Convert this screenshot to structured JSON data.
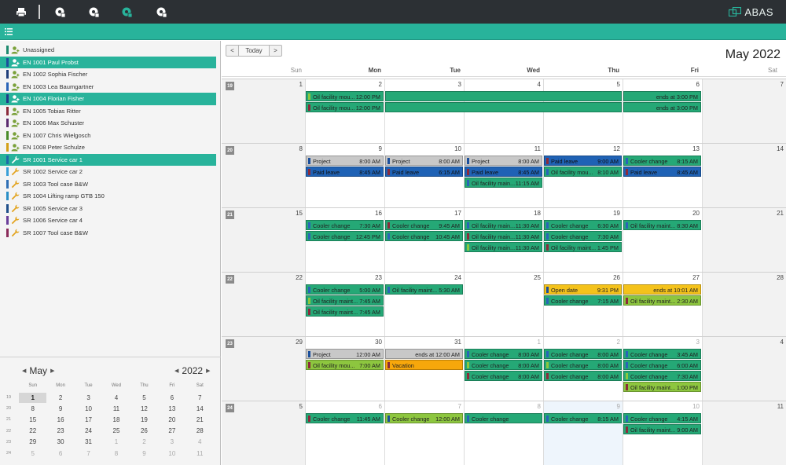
{
  "toolbar": {
    "icons": [
      "printer-icon",
      "gear-view-icon",
      "gear-view-icon",
      "gear-view-active-icon",
      "gear-view-icon"
    ],
    "logo_text": "ABAS"
  },
  "colors": {
    "toolbar_bg": "#2c3034",
    "accent": "#28b39b",
    "event_green": "#25a876",
    "event_gray": "#c8c8c8",
    "event_blue": "#1f62b5",
    "event_lime": "#8dc63f",
    "event_yellow": "#f4c21b",
    "event_orange": "#f7a70b"
  },
  "resources": [
    {
      "label": "Unassigned",
      "bar": "#1e8a6e",
      "icon": "person-icon",
      "selected": false
    },
    {
      "label": "EN 1001 Paul Probst",
      "bar": "#1b4f9c",
      "icon": "person-icon",
      "selected": true
    },
    {
      "label": "EN 1002 Sophia Fischer",
      "bar": "#1f3e7a",
      "icon": "person-icon",
      "selected": false
    },
    {
      "label": "EN 1003 Lea Baumgartner",
      "bar": "#2a64b7",
      "icon": "person-icon",
      "selected": false
    },
    {
      "label": "EN 1004 Florian Fisher",
      "bar": "#1e3a8a",
      "icon": "person-icon",
      "selected": true
    },
    {
      "label": "EN 1005 Tobias Ritter",
      "bar": "#8b2b3b",
      "icon": "person-icon",
      "selected": false
    },
    {
      "label": "EN 1006 Max Schuster",
      "bar": "#5b2a6e",
      "icon": "person-icon",
      "selected": false
    },
    {
      "label": "EN 1007 Chris Wielgosch",
      "bar": "#4a8c2a",
      "icon": "person-icon",
      "selected": false
    },
    {
      "label": "EN 1008 Peter Schulze",
      "bar": "#d4a017",
      "icon": "person-icon",
      "selected": false
    },
    {
      "label": "SR 1001 Service car 1",
      "bar": "#1e6aa8",
      "icon": "wrench-icon",
      "selected": true
    },
    {
      "label": "SR 1002 Service car 2",
      "bar": "#3aa0d8",
      "icon": "wrench-icon",
      "selected": false
    },
    {
      "label": "SR 1003 Tool case B&W",
      "bar": "#2f6fb5",
      "icon": "wrench-icon",
      "selected": false
    },
    {
      "label": "SR 1004 Lifting ramp GTB 150",
      "bar": "#2a8fc6",
      "icon": "wrench-icon",
      "selected": false
    },
    {
      "label": "SR 1005 Service car 3",
      "bar": "#1f4f8a",
      "icon": "wrench-icon",
      "selected": false
    },
    {
      "label": "SR 1006 Service car 4",
      "bar": "#6a3d9a",
      "icon": "wrench-icon",
      "selected": false
    },
    {
      "label": "SR 1007 Tool case B&W",
      "bar": "#8a2a5a",
      "icon": "wrench-icon",
      "selected": false
    }
  ],
  "minical": {
    "month": "May",
    "year": "2022",
    "dow": [
      "Sun",
      "Mon",
      "Tue",
      "Wed",
      "Thu",
      "Fri",
      "Sat"
    ],
    "weeks": [
      {
        "wk": "19",
        "days": [
          {
            "d": "1",
            "c": "today"
          },
          {
            "d": "2"
          },
          {
            "d": "3"
          },
          {
            "d": "4"
          },
          {
            "d": "5"
          },
          {
            "d": "6"
          },
          {
            "d": "7"
          }
        ]
      },
      {
        "wk": "20",
        "days": [
          {
            "d": "8"
          },
          {
            "d": "9"
          },
          {
            "d": "10"
          },
          {
            "d": "11"
          },
          {
            "d": "12"
          },
          {
            "d": "13"
          },
          {
            "d": "14"
          }
        ]
      },
      {
        "wk": "21",
        "days": [
          {
            "d": "15"
          },
          {
            "d": "16"
          },
          {
            "d": "17"
          },
          {
            "d": "18"
          },
          {
            "d": "19"
          },
          {
            "d": "20"
          },
          {
            "d": "21"
          }
        ]
      },
      {
        "wk": "22",
        "days": [
          {
            "d": "22"
          },
          {
            "d": "23"
          },
          {
            "d": "24"
          },
          {
            "d": "25"
          },
          {
            "d": "26"
          },
          {
            "d": "27"
          },
          {
            "d": "28"
          }
        ]
      },
      {
        "wk": "23",
        "days": [
          {
            "d": "29"
          },
          {
            "d": "30"
          },
          {
            "d": "31"
          },
          {
            "d": "1",
            "c": "other"
          },
          {
            "d": "2",
            "c": "other"
          },
          {
            "d": "3",
            "c": "other"
          },
          {
            "d": "4",
            "c": "other"
          }
        ]
      },
      {
        "wk": "24",
        "days": [
          {
            "d": "5",
            "c": "other"
          },
          {
            "d": "6",
            "c": "other"
          },
          {
            "d": "7",
            "c": "other"
          },
          {
            "d": "8",
            "c": "other"
          },
          {
            "d": "9",
            "c": "other"
          },
          {
            "d": "10",
            "c": "other"
          },
          {
            "d": "11",
            "c": "other"
          }
        ]
      }
    ]
  },
  "calendar": {
    "today_label": "Today",
    "prev_label": "<",
    "next_label": ">",
    "title": "May 2022",
    "dow": [
      "Sun",
      "Mon",
      "Tue",
      "Wed",
      "Thu",
      "Fri",
      "Sat"
    ],
    "weeks": [
      {
        "wk": "19",
        "days": [
          {
            "d": "1"
          },
          {
            "d": "2"
          },
          {
            "d": "3"
          },
          {
            "d": "4"
          },
          {
            "d": "5"
          },
          {
            "d": "6"
          },
          {
            "d": "7"
          }
        ],
        "events": [
          {
            "col": 1,
            "span": 1,
            "row": 0,
            "text": "Oil facility mou...",
            "time": "12:00 PM",
            "color": "event_green",
            "bar": "#8dc63f"
          },
          {
            "col": 2,
            "span": 3,
            "row": 0,
            "text": "",
            "time": "",
            "color": "event_green",
            "bar": ""
          },
          {
            "col": 5,
            "span": 1,
            "row": 0,
            "text": "",
            "time": "ends at 3:00 PM",
            "color": "event_green",
            "bar": ""
          },
          {
            "col": 1,
            "span": 1,
            "row": 1,
            "text": "Oil facility mou...",
            "time": "12:00 PM",
            "color": "event_green",
            "bar": "#8b2b3b"
          },
          {
            "col": 2,
            "span": 3,
            "row": 1,
            "text": "",
            "time": "",
            "color": "event_green",
            "bar": ""
          },
          {
            "col": 5,
            "span": 1,
            "row": 1,
            "text": "",
            "time": "ends at 3:00 PM",
            "color": "event_green",
            "bar": ""
          }
        ]
      },
      {
        "wk": "20",
        "days": [
          {
            "d": "8"
          },
          {
            "d": "9"
          },
          {
            "d": "10"
          },
          {
            "d": "11"
          },
          {
            "d": "12"
          },
          {
            "d": "13"
          },
          {
            "d": "14"
          }
        ],
        "events": [
          {
            "col": 1,
            "row": 0,
            "text": "Project",
            "time": "8:00 AM",
            "color": "event_gray",
            "bar": "#1b4f9c"
          },
          {
            "col": 2,
            "row": 0,
            "text": "Project",
            "time": "8:00 AM",
            "color": "event_gray",
            "bar": "#1b4f9c"
          },
          {
            "col": 3,
            "row": 0,
            "text": "Project",
            "time": "8:00 AM",
            "color": "event_gray",
            "bar": "#1b4f9c"
          },
          {
            "col": 4,
            "row": 0,
            "text": "Paid leave",
            "time": "9:00 AM",
            "color": "event_blue",
            "bar": "#8b2b3b"
          },
          {
            "col": 5,
            "row": 0,
            "text": "Cooler change",
            "time": "8:15 AM",
            "color": "event_green",
            "bar": "#2a64b7"
          },
          {
            "col": 1,
            "row": 1,
            "text": "Paid leave",
            "time": "8:45 AM",
            "color": "event_blue",
            "bar": "#8b2b3b"
          },
          {
            "col": 2,
            "row": 1,
            "text": "Paid leave",
            "time": "6:15 AM",
            "color": "event_blue",
            "bar": "#8b2b3b"
          },
          {
            "col": 3,
            "row": 1,
            "text": "Paid leave",
            "time": "8:45 AM",
            "color": "event_blue",
            "bar": "#8b2b3b"
          },
          {
            "col": 4,
            "row": 1,
            "text": "Oil facility mou...",
            "time": "8:10 AM",
            "color": "event_green",
            "bar": "#2a64b7"
          },
          {
            "col": 5,
            "row": 1,
            "text": "Paid leave",
            "time": "8:45 AM",
            "color": "event_blue",
            "bar": "#8b2b3b"
          },
          {
            "col": 3,
            "row": 2,
            "text": "Oil facility main...",
            "time": "11:15 AM",
            "color": "event_green",
            "bar": "#2a64b7"
          }
        ]
      },
      {
        "wk": "21",
        "days": [
          {
            "d": "15"
          },
          {
            "d": "16"
          },
          {
            "d": "17"
          },
          {
            "d": "18"
          },
          {
            "d": "19"
          },
          {
            "d": "20"
          },
          {
            "d": "21"
          }
        ],
        "events": [
          {
            "col": 1,
            "row": 0,
            "text": "Cooler change",
            "time": "7:30 AM",
            "color": "event_green",
            "bar": "#2a64b7"
          },
          {
            "col": 2,
            "row": 0,
            "text": "Cooler change",
            "time": "9:45 AM",
            "color": "event_green",
            "bar": "#8b2b3b"
          },
          {
            "col": 3,
            "row": 0,
            "text": "Oil facility main...",
            "time": "11:30 AM",
            "color": "event_green",
            "bar": "#2a64b7"
          },
          {
            "col": 4,
            "row": 0,
            "text": "Cooler change",
            "time": "6:30 AM",
            "color": "event_green",
            "bar": "#2a64b7"
          },
          {
            "col": 5,
            "row": 0,
            "text": "Oil facility maint...",
            "time": "8:30 AM",
            "color": "event_green",
            "bar": "#2a64b7"
          },
          {
            "col": 1,
            "row": 1,
            "text": "Cooler change",
            "time": "12:45 PM",
            "color": "event_green",
            "bar": "#2a64b7"
          },
          {
            "col": 2,
            "row": 1,
            "text": "Cooler change",
            "time": "10:45 AM",
            "color": "event_green",
            "bar": "#2a64b7"
          },
          {
            "col": 3,
            "row": 1,
            "text": "Oil facility main...",
            "time": "11:30 AM",
            "color": "event_green",
            "bar": "#8b2b3b"
          },
          {
            "col": 4,
            "row": 1,
            "text": "Cooler change",
            "time": "7:30 AM",
            "color": "event_green",
            "bar": "#2a64b7"
          },
          {
            "col": 3,
            "row": 2,
            "text": "Oil facility main...",
            "time": "11:30 AM",
            "color": "event_green",
            "bar": "#8dc63f"
          },
          {
            "col": 4,
            "row": 2,
            "text": "Oil facility maint...",
            "time": "1:45 PM",
            "color": "event_green",
            "bar": "#8b2b3b"
          }
        ]
      },
      {
        "wk": "22",
        "days": [
          {
            "d": "22"
          },
          {
            "d": "23"
          },
          {
            "d": "24"
          },
          {
            "d": "25"
          },
          {
            "d": "26"
          },
          {
            "d": "27"
          },
          {
            "d": "28"
          }
        ],
        "events": [
          {
            "col": 1,
            "row": 0,
            "text": "Cooler change",
            "time": "5:00 AM",
            "color": "event_green",
            "bar": "#2a64b7"
          },
          {
            "col": 2,
            "row": 0,
            "text": "Oil facility maint...",
            "time": "5:30 AM",
            "color": "event_green",
            "bar": "#2a64b7"
          },
          {
            "col": 4,
            "row": 0,
            "text": "Open date",
            "time": "9:31 PM",
            "color": "event_yellow",
            "bar": "#1b4f9c"
          },
          {
            "col": 5,
            "row": 0,
            "text": "",
            "time": "ends at 10:01 AM",
            "color": "event_yellow",
            "bar": ""
          },
          {
            "col": 1,
            "row": 1,
            "text": "Oil facility maint...",
            "time": "7:45 AM",
            "color": "event_green",
            "bar": "#8dc63f"
          },
          {
            "col": 4,
            "row": 1,
            "text": "Cooler change",
            "time": "7:15 AM",
            "color": "event_green",
            "bar": "#2a64b7"
          },
          {
            "col": 5,
            "row": 1,
            "text": "Oil facility maint...",
            "time": "2:30 AM",
            "color": "event_lime",
            "bar": "#8b2b3b"
          },
          {
            "col": 1,
            "row": 2,
            "text": "Oil facility maint...",
            "time": "7:45 AM",
            "color": "event_green",
            "bar": "#8b2b3b"
          }
        ]
      },
      {
        "wk": "23",
        "days": [
          {
            "d": "29"
          },
          {
            "d": "30"
          },
          {
            "d": "31"
          },
          {
            "d": "1",
            "c": "other"
          },
          {
            "d": "2",
            "c": "other"
          },
          {
            "d": "3",
            "c": "other"
          },
          {
            "d": "4"
          }
        ],
        "events": [
          {
            "col": 1,
            "row": 0,
            "text": "Project",
            "time": "12:00 AM",
            "color": "event_gray",
            "bar": "#1b4f9c"
          },
          {
            "col": 2,
            "row": 0,
            "text": "",
            "time": "ends at 12:00 AM",
            "color": "event_gray",
            "bar": ""
          },
          {
            "col": 3,
            "row": 0,
            "text": "Cooler change",
            "time": "8:00 AM",
            "color": "event_green",
            "bar": "#2a64b7"
          },
          {
            "col": 4,
            "row": 0,
            "text": "Cooler change",
            "time": "8:00 AM",
            "color": "event_green",
            "bar": "#2a64b7"
          },
          {
            "col": 5,
            "row": 0,
            "text": "Cooler change",
            "time": "3:45 AM",
            "color": "event_green",
            "bar": "#2a64b7"
          },
          {
            "col": 1,
            "row": 1,
            "text": "Oil facility mou...",
            "time": "7:00 AM",
            "color": "event_lime",
            "bar": "#8b2b3b"
          },
          {
            "col": 2,
            "row": 1,
            "text": "Vacation",
            "time": "",
            "color": "event_orange",
            "bar": "#8b2b3b"
          },
          {
            "col": 3,
            "row": 1,
            "text": "Cooler change",
            "time": "8:00 AM",
            "color": "event_green",
            "bar": "#8dc63f"
          },
          {
            "col": 4,
            "row": 1,
            "text": "Cooler change",
            "time": "8:00 AM",
            "color": "event_green",
            "bar": "#8dc63f"
          },
          {
            "col": 5,
            "row": 1,
            "text": "Cooler change",
            "time": "6:00 AM",
            "color": "event_green",
            "bar": "#2a64b7"
          },
          {
            "col": 3,
            "row": 2,
            "text": "Cooler change",
            "time": "8:00 AM",
            "color": "event_green",
            "bar": "#8b2b3b"
          },
          {
            "col": 4,
            "row": 2,
            "text": "Cooler change",
            "time": "8:00 AM",
            "color": "event_green",
            "bar": "#8b2b3b"
          },
          {
            "col": 5,
            "row": 2,
            "text": "Cooler change",
            "time": "7:30 AM",
            "color": "event_green",
            "bar": "#8dc63f"
          },
          {
            "col": 5,
            "row": 3,
            "text": "Oil facility maint...",
            "time": "1:00 PM",
            "color": "event_lime",
            "bar": "#8b2b3b"
          }
        ]
      },
      {
        "wk": "24",
        "days": [
          {
            "d": "5"
          },
          {
            "d": "6",
            "c": "other"
          },
          {
            "d": "7",
            "c": "other"
          },
          {
            "d": "8",
            "c": "other"
          },
          {
            "d": "9",
            "c": "other",
            "t": "today"
          },
          {
            "d": "10",
            "c": "other"
          },
          {
            "d": "11"
          }
        ],
        "events": [
          {
            "col": 1,
            "row": 0,
            "text": "Cooler change",
            "time": "11:45 AM",
            "color": "event_green",
            "bar": "#8b2b3b"
          },
          {
            "col": 2,
            "row": 0,
            "text": "Cooler change",
            "time": "12:00 AM",
            "color": "event_lime",
            "bar": "#1b4f9c"
          },
          {
            "col": 3,
            "row": 0,
            "text": "Cooler change",
            "time": "",
            "color": "event_green",
            "bar": "#2a64b7"
          },
          {
            "col": 4,
            "row": 0,
            "text": "Cooler change",
            "time": "8:15 AM",
            "color": "event_green",
            "bar": "#2a64b7"
          },
          {
            "col": 5,
            "row": 0,
            "text": "Cooler change",
            "time": "4:15 AM",
            "color": "event_green",
            "bar": "#2a64b7"
          },
          {
            "col": 5,
            "row": 1,
            "text": "Oil facility maint...",
            "time": "9:00 AM",
            "color": "event_green",
            "bar": "#8b2b3b"
          }
        ]
      }
    ]
  }
}
